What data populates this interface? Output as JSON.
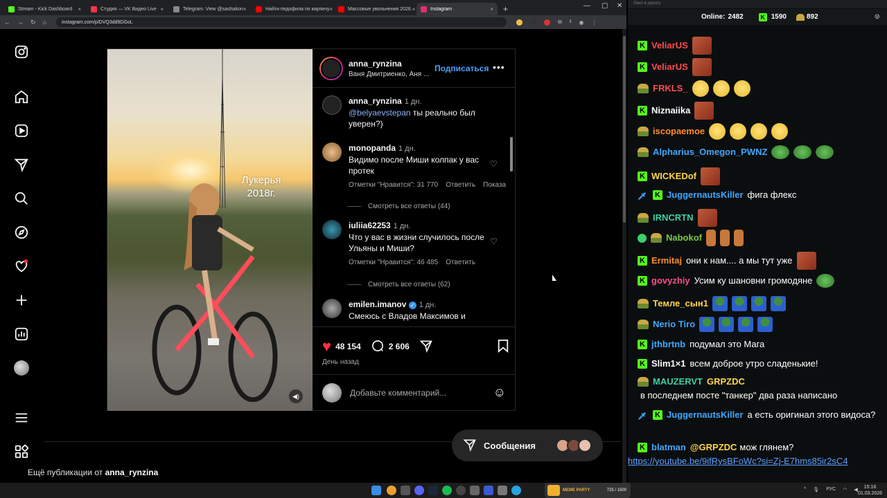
{
  "browser": {
    "tabs": [
      {
        "label": "Stream - Kick Dashboard",
        "color": "#53fc18"
      },
      {
        "label": "Студия — VK Видео Live",
        "color": "#ff3347"
      },
      {
        "label": "Telegram: View @sashakon",
        "color": "#888888"
      },
      {
        "label": "Найти педофила по кирпичу",
        "color": "#ff0000"
      },
      {
        "label": "Массовые увольнения 2026.",
        "color": "#ff0000"
      },
      {
        "label": "Instagram",
        "color": "#e1306c"
      }
    ],
    "url": "instagram.com/p/DVQ3dd9DGoL"
  },
  "post": {
    "username": "anna_rynzina",
    "subtitle": "Ваня Дмитриенко, Аня ...",
    "follow_label": "Подписаться",
    "media_caption_line1": "Лукерья",
    "media_caption_line2": "2018г.",
    "comments": [
      {
        "user": "anna_rynzina",
        "time": "1 дн.",
        "mention": "@belyaevstepan",
        "text": " ты реально был уверен?)"
      },
      {
        "user": "monopanda",
        "time": "1 дн.",
        "text": "Видимо после Миши колпак у вас протек",
        "likes": "Отметки \"Нравится\": 31 770",
        "reply": "Ответить",
        "show": "Показа",
        "view_all": "Смотреть все ответы (44)"
      },
      {
        "user": "iuliia62253",
        "time": "1 дн.",
        "text": "Что у вас в жизни случилось после Ульяны и Миши?",
        "likes": "Отметки \"Нравится\": 46 485",
        "reply": "Ответить",
        "view_all": "Смотреть все ответы (62)"
      },
      {
        "user": "emilen.imanov",
        "time": "1 дн.",
        "text": "Смеюсь с Владов Максимов и"
      }
    ],
    "likes_count": "48 154",
    "comments_count": "2 606",
    "date": "День назад",
    "add_comment_placeholder": "Добавьте комментарий..."
  },
  "more_from_prefix": "Ещё публикации от",
  "more_from_user": "anna_rynzina",
  "messages_label": "Сообщения",
  "chat": {
    "window_title": "Окно в дорогу",
    "online_label": "Online:",
    "online_count": "2482",
    "kick_count": "1590",
    "other_count": "892",
    "messages": [
      {
        "user": "VeliarUS",
        "color": "#ff4d4d",
        "badge": "kick",
        "emotes": [
          "face"
        ]
      },
      {
        "user": "VeliarUS",
        "color": "#ff4d4d",
        "badge": "kick",
        "emotes": [
          "face"
        ]
      },
      {
        "user": "FRKLS_",
        "color": "#ff4d4d",
        "badge": "sub",
        "emotes": [
          "sleep",
          "sleep",
          "sleep"
        ]
      },
      {
        "user": "Niznaiika",
        "color": "#ffffff",
        "badge": "kick",
        "emotes": [
          "face"
        ]
      },
      {
        "user": "iscopaemoe",
        "color": "#ff8c2a",
        "badge": "sub",
        "emotes": [
          "sleep",
          "sleep",
          "sleep",
          "sleep"
        ]
      },
      {
        "user": "Alpharius_Omegon_PWNZ",
        "color": "#3fa7ff",
        "badge": "sub",
        "emotes": [
          "pepe",
          "pepe",
          "pepe"
        ]
      },
      {
        "user": "WICKEDof",
        "color": "#ffd54a",
        "badge": "kick",
        "emotes": [
          "face"
        ]
      },
      {
        "user": "JuggernautsKiller",
        "color": "#3fa7ff",
        "badge": "kick2",
        "text": "фига флекс"
      },
      {
        "user": "IRNCRTN",
        "color": "#3ccfa0",
        "badge": "sub",
        "emotes": [
          "face"
        ]
      },
      {
        "user": "Nabokof",
        "color": "#7ac943",
        "badge": "sub2",
        "emotes": [
          "bear",
          "bear",
          "bear"
        ]
      },
      {
        "user": "Ermitaj",
        "color": "#ff8c2a",
        "badge": "kick",
        "text": "они к нам.... а мы тут уже",
        "emotes": [
          "face"
        ]
      },
      {
        "user": "govyzhiy",
        "color": "#ff4d8a",
        "badge": "kick",
        "text": "Усим ку шановни громодяне",
        "emotes": [
          "pepe"
        ]
      },
      {
        "user": "Темле_сын1",
        "color": "#ffd54a",
        "badge": "sub",
        "emotes": [
          "frog",
          "frog",
          "frog",
          "frog"
        ]
      },
      {
        "user": "Nerio Tiro",
        "color": "#3fa7ff",
        "badge": "sub",
        "emotes": [
          "frog",
          "frog",
          "frog",
          "frog"
        ]
      },
      {
        "user": "jthbrtnb",
        "color": "#3fa7ff",
        "badge": "kick",
        "text": "подумал это Мага"
      },
      {
        "user": "Slim1×1",
        "color": "#ffffff",
        "badge": "kick",
        "text": "всем доброе утро сладенькие!"
      },
      {
        "user": "MAUZERVT",
        "color": "#3ccfa0",
        "badge": "sub",
        "mention": "GRPZDC",
        "text": "в последнем посте \"танкер\" два раза написано"
      },
      {
        "user": "JuggernautsKiller",
        "color": "#3fa7ff",
        "badge": "kick2",
        "text": "а есть оригинал этого видоса?"
      },
      {
        "user": "blatman",
        "color": "#3fa7ff",
        "badge": "kick",
        "mention": "@GRPZDC",
        "text": "мож глянем?",
        "link": "https://youtube.be/9ifRysBFoWc?si=Zj-E7hms85ir2sC4"
      }
    ]
  },
  "taskbar": {
    "time": "15:16",
    "date": "01.03.2026",
    "lang": "РУС",
    "widget_text": "MEME PARTY",
    "widget_sub": "725 / 1500"
  }
}
